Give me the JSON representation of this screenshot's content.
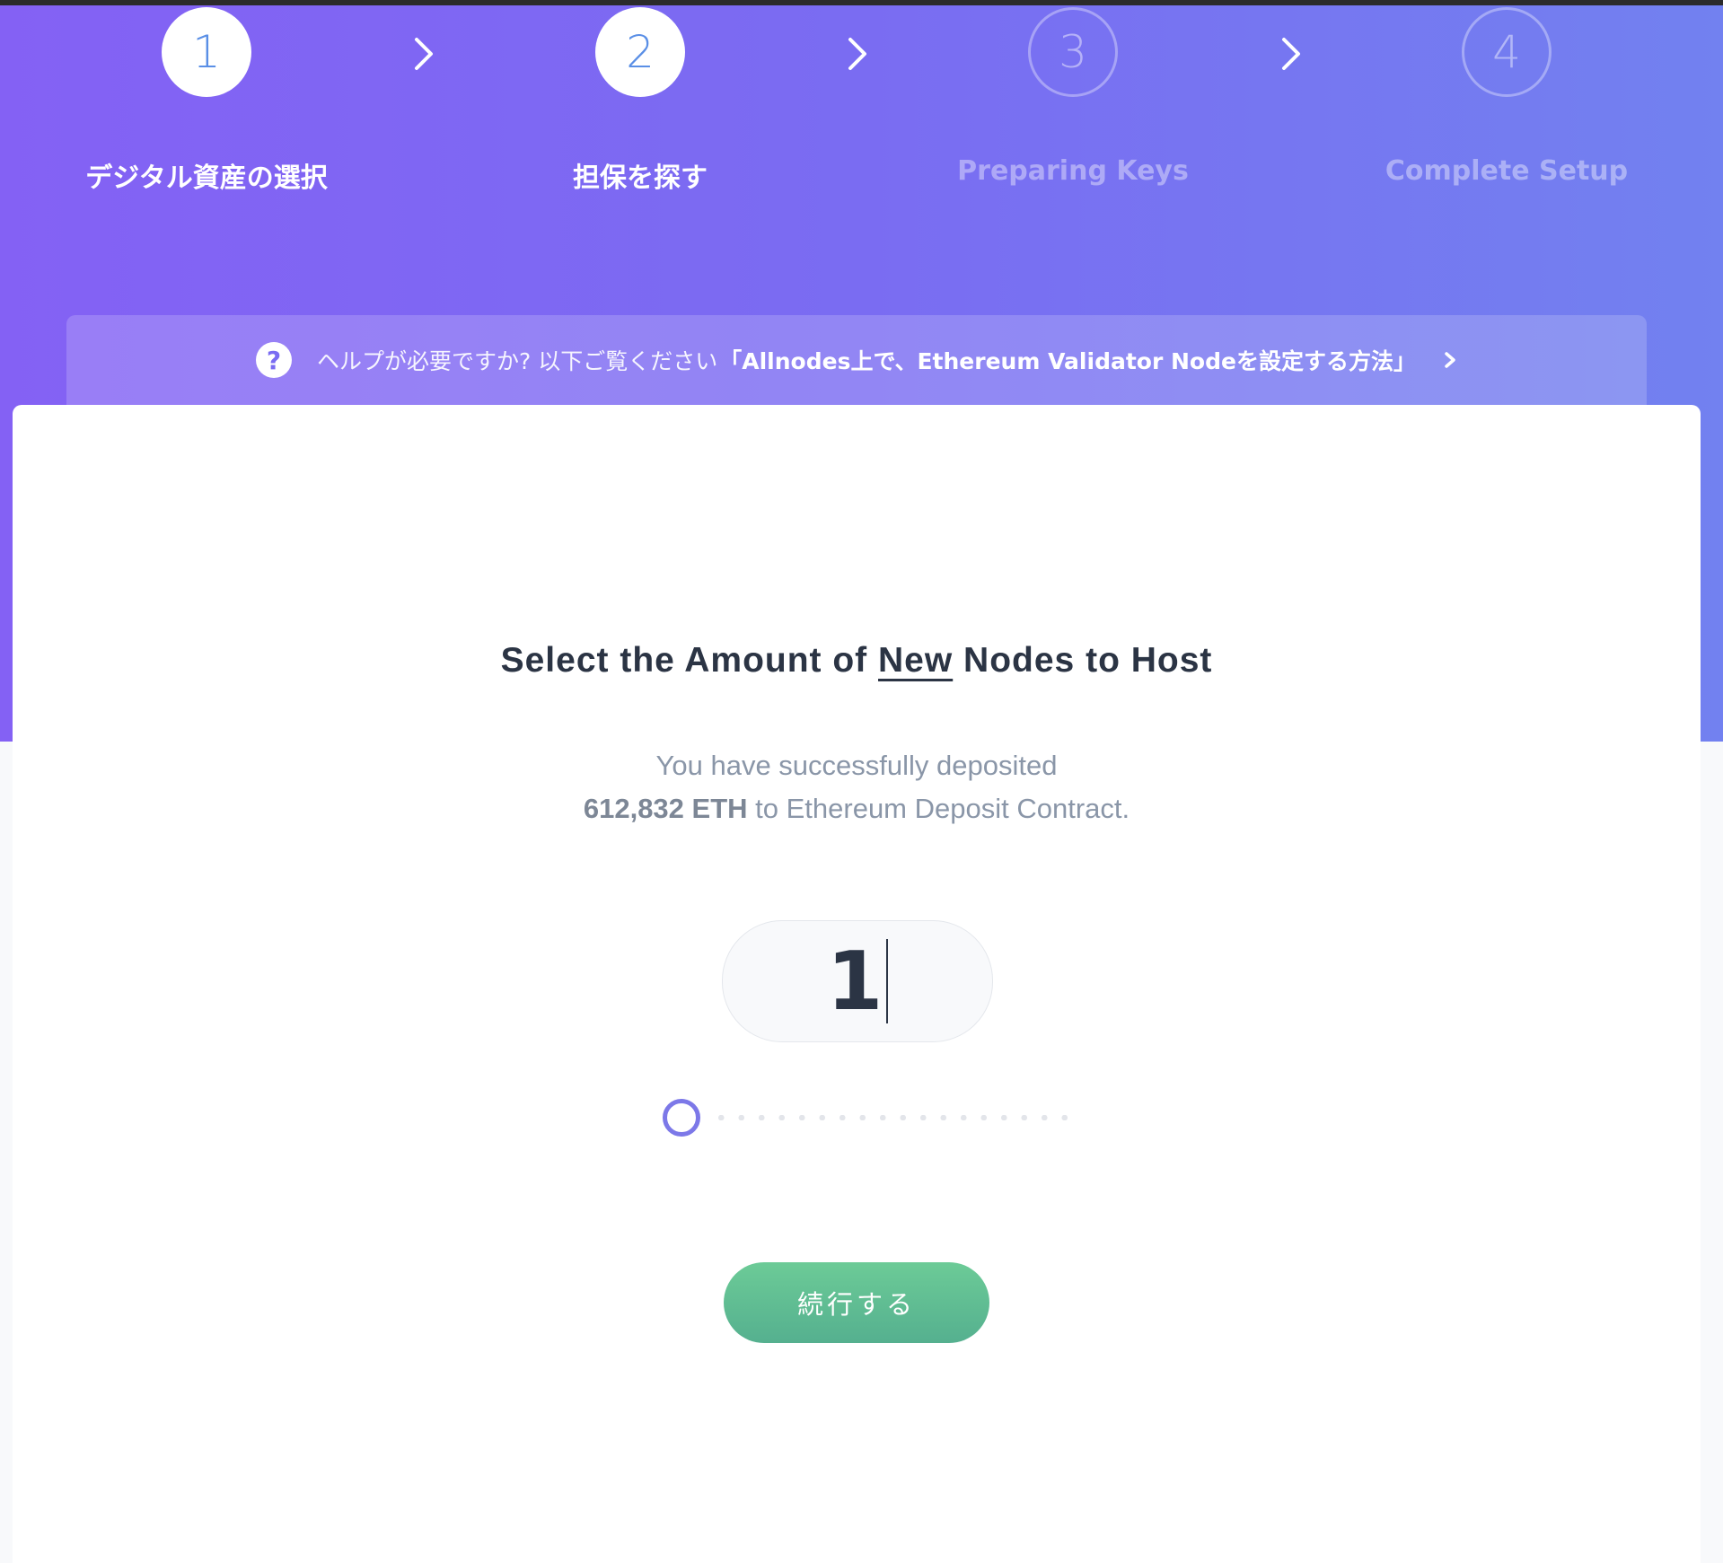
{
  "steps": [
    {
      "number": "1",
      "label": "デジタル資産の選択",
      "state": "active"
    },
    {
      "number": "2",
      "label": "担保を探す",
      "state": "active"
    },
    {
      "number": "3",
      "label": "Preparing Keys",
      "state": "inactive"
    },
    {
      "number": "4",
      "label": "Complete Setup",
      "state": "inactive"
    }
  ],
  "help": {
    "icon": "question-icon",
    "text": "ヘルプが必要ですか? 以下ご覧ください",
    "link": "「Allnodes上で、Ethereum Validator Nodeを設定する方法」"
  },
  "main": {
    "heading_before": "Select the Amount of ",
    "heading_emphasis": "New",
    "heading_after": " Nodes to Host",
    "line1": "You have successfully deposited",
    "amount": "612,832 ETH",
    "line2_rest": " to Ethereum Deposit Contract.",
    "node_count": "1",
    "continue_label": "続行する"
  },
  "colors": {
    "gradient_start": "#8461f4",
    "gradient_end": "#7281f0",
    "active_number": "#5a8fe6",
    "continue_button": "#5fbd93",
    "slider_handle": "#7c78e8"
  }
}
